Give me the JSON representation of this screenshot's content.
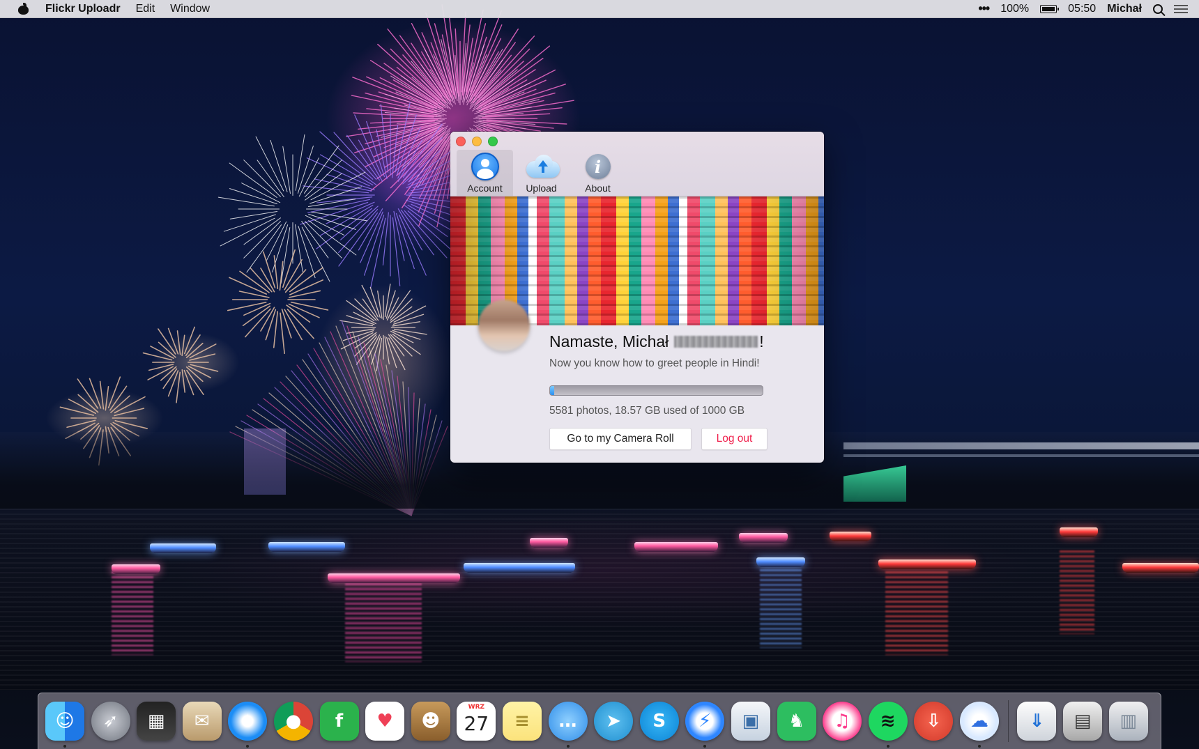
{
  "menubar": {
    "app_name": "Flickr Uploadr",
    "menus": [
      "Edit",
      "Window"
    ],
    "battery": "100%",
    "time": "05:50",
    "user": "Michał"
  },
  "window": {
    "tabs": [
      {
        "label": "Account",
        "icon": "account-icon",
        "active": true
      },
      {
        "label": "Upload",
        "icon": "cloud-upload-icon",
        "active": false
      },
      {
        "label": "About",
        "icon": "info-icon",
        "active": false
      }
    ],
    "greeting": "Namaste, Michał",
    "greeting_suffix": "!",
    "subtitle": "Now you know how to greet people in Hindi!",
    "storage_text": "5581 photos, 18.57 GB used of 1000 GB",
    "storage_used_fraction": 0.0186,
    "camera_roll_button": "Go to my Camera Roll",
    "logout_button": "Log out"
  },
  "colors": {
    "accent_blue": "#1575e8",
    "logout_red": "#f0204c",
    "progress_fill": "#2a8ff0"
  },
  "dock": {
    "items": [
      {
        "name": "finder",
        "icon": "finder-icon",
        "running": true
      },
      {
        "name": "launchpad",
        "icon": "rocket-icon",
        "running": false
      },
      {
        "name": "mission-control",
        "icon": "mission-control-icon",
        "running": false
      },
      {
        "name": "mail",
        "icon": "mail-stamp-icon",
        "running": false
      },
      {
        "name": "safari",
        "icon": "compass-icon",
        "running": true
      },
      {
        "name": "chrome",
        "icon": "chrome-icon",
        "running": false
      },
      {
        "name": "feedly",
        "icon": "feedly-icon",
        "running": false
      },
      {
        "name": "pocket",
        "icon": "pocket-icon",
        "running": false
      },
      {
        "name": "contacts",
        "icon": "contacts-book-icon",
        "running": false
      },
      {
        "name": "calendar",
        "icon": "calendar-icon",
        "running": false,
        "month": "WRZ",
        "day": "27"
      },
      {
        "name": "notes",
        "icon": "notes-icon",
        "running": false
      },
      {
        "name": "messages",
        "icon": "speech-bubble-icon",
        "running": true
      },
      {
        "name": "telegram",
        "icon": "paper-plane-icon",
        "running": false
      },
      {
        "name": "skype",
        "icon": "skype-icon",
        "running": false
      },
      {
        "name": "messenger",
        "icon": "messenger-icon",
        "running": true
      },
      {
        "name": "preview",
        "icon": "preview-icon",
        "running": false
      },
      {
        "name": "evernote",
        "icon": "elephant-icon",
        "running": false
      },
      {
        "name": "itunes",
        "icon": "music-note-icon",
        "running": false
      },
      {
        "name": "spotify",
        "icon": "spotify-icon",
        "running": true
      },
      {
        "name": "transmit",
        "icon": "download-box-icon",
        "running": false
      },
      {
        "name": "flickr-uploadr",
        "icon": "cloud-upload-icon",
        "running": true
      },
      {
        "name": "downloads",
        "icon": "downloads-stack-icon",
        "running": false
      },
      {
        "name": "documents",
        "icon": "folder-stack-icon",
        "running": false
      },
      {
        "name": "trash",
        "icon": "trash-icon",
        "running": false
      }
    ]
  }
}
